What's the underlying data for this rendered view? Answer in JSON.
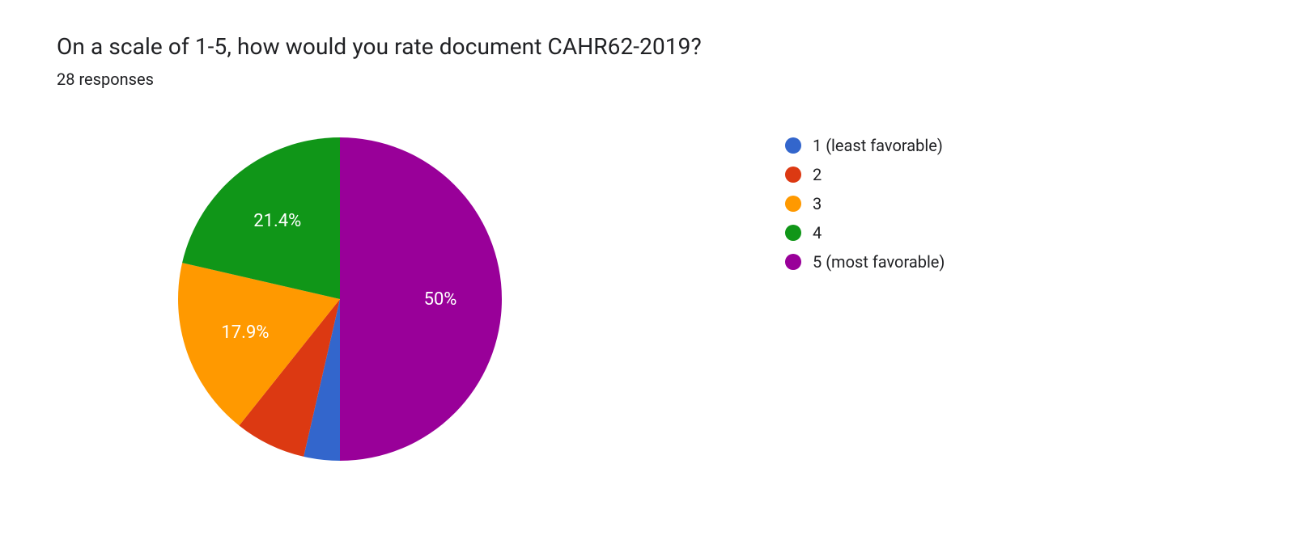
{
  "title": "On a scale of 1-5, how would you rate document CAHR62-2019?",
  "subtitle": "28 responses",
  "chart_data": {
    "type": "pie",
    "categories": [
      "1 (least favorable)",
      "2",
      "3",
      "4",
      "5 (most favorable)"
    ],
    "values": [
      3.6,
      7.1,
      17.9,
      21.4,
      50.0
    ],
    "series_colors": [
      "#3366cc",
      "#dc3912",
      "#ff9900",
      "#109618",
      "#990099"
    ],
    "visible_labels": {
      "0": "",
      "1": "",
      "2": "17.9%",
      "3": "21.4%",
      "4": "50%"
    }
  }
}
